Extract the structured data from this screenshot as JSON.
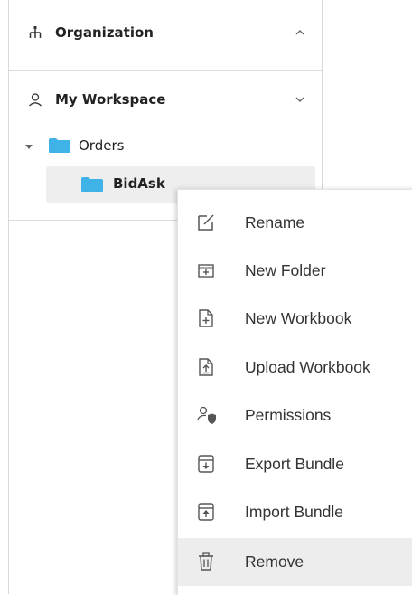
{
  "sidebar": {
    "organization": {
      "title": "Organization",
      "icon": "hierarchy-icon",
      "state": "expanded"
    },
    "workspace": {
      "title": "My Workspace",
      "icon": "user-icon",
      "state": "collapsed",
      "tree": [
        {
          "label": "Orders",
          "icon": "folder-icon",
          "expanded": true
        },
        {
          "label": "BidAsk",
          "icon": "folder-icon",
          "selected": true
        }
      ]
    }
  },
  "context_menu": {
    "items": [
      {
        "label": "Rename",
        "icon": "rename-icon"
      },
      {
        "label": "New Folder",
        "icon": "new-folder-icon"
      },
      {
        "label": "New Workbook",
        "icon": "new-workbook-icon"
      },
      {
        "label": "Upload Workbook",
        "icon": "upload-workbook-icon"
      },
      {
        "label": "Permissions",
        "icon": "permissions-icon"
      },
      {
        "label": "Export Bundle",
        "icon": "export-bundle-icon"
      },
      {
        "label": "Import Bundle",
        "icon": "import-bundle-icon"
      },
      {
        "label": "Remove",
        "icon": "trash-icon",
        "hovered": true
      }
    ]
  },
  "colors": {
    "folder": "#3fb2e8",
    "menu_hover": "#ededed",
    "border": "#d9d9d9"
  }
}
